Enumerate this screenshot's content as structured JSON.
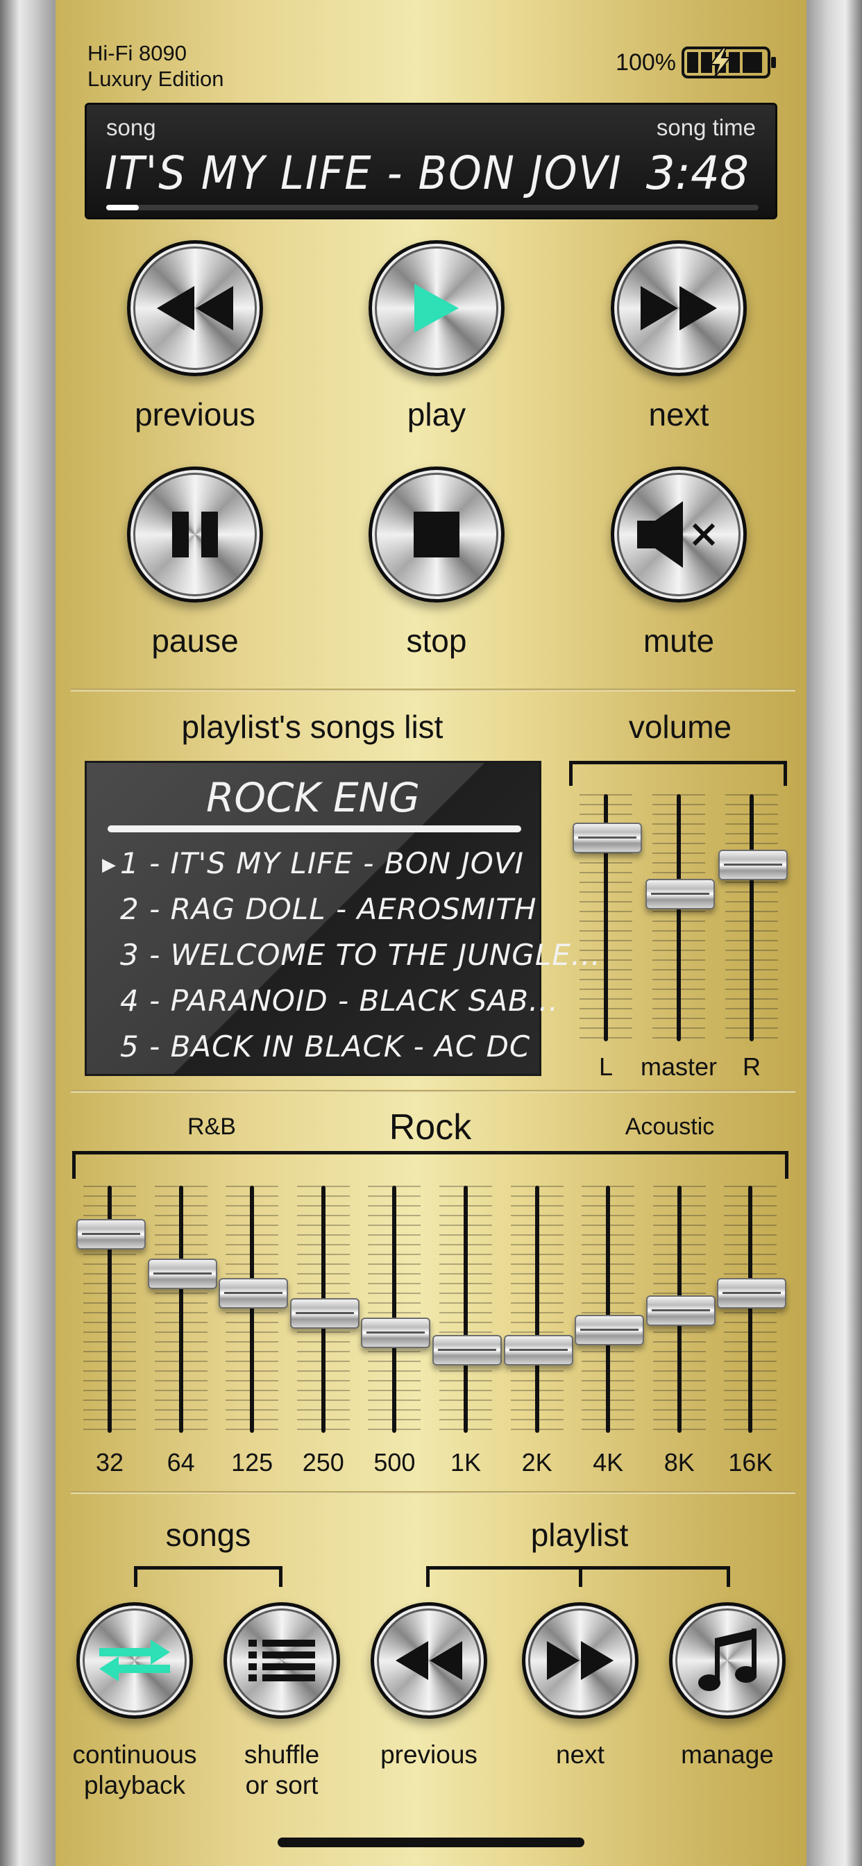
{
  "device": {
    "brand_line1": "Hi-Fi 8090",
    "brand_line2": "Luxury Edition",
    "battery": "100%",
    "battery_icon": "battery-charging-icon"
  },
  "display": {
    "song_label": "song",
    "time_label": "song time",
    "song_title": "IT'S MY LIFE - BON JOVI",
    "song_time": "3:48",
    "progress": 0.05
  },
  "transport": {
    "previous": "previous",
    "play": "play",
    "next": "next",
    "pause": "pause",
    "stop": "stop",
    "mute": "mute",
    "play_accent": "#2de0b5"
  },
  "playlist": {
    "section_title": "playlist's songs list",
    "name": "ROCK ENG",
    "songs": [
      "1 - IT'S MY LIFE - BON JOVI",
      "2 - RAG DOLL - AEROSMITH",
      "3 - WELCOME TO THE JUNGLE...",
      "4 - PARANOID - BLACK SAB...",
      "5 - BACK IN BLACK - AC DC"
    ],
    "current_index": 0
  },
  "volume": {
    "title": "volume",
    "sliders": [
      {
        "label": "L",
        "level": 0.83
      },
      {
        "label": "master",
        "level": 0.6
      },
      {
        "label": "R",
        "level": 0.72
      }
    ]
  },
  "equalizer": {
    "preset_left": "R&B",
    "preset_current": "Rock",
    "preset_right": "Acoustic",
    "bands": [
      {
        "label": "32",
        "level": 0.81
      },
      {
        "label": "64",
        "level": 0.65
      },
      {
        "label": "125",
        "level": 0.57
      },
      {
        "label": "250",
        "level": 0.49
      },
      {
        "label": "500",
        "level": 0.41
      },
      {
        "label": "1K",
        "level": 0.34
      },
      {
        "label": "2K",
        "level": 0.34
      },
      {
        "label": "4K",
        "level": 0.42
      },
      {
        "label": "8K",
        "level": 0.5
      },
      {
        "label": "16K",
        "level": 0.57
      }
    ]
  },
  "bottom": {
    "songs_title": "songs",
    "playlist_title": "playlist",
    "continuous_1": "continuous",
    "continuous_2": "playback",
    "shuffle_1": "shuffle",
    "shuffle_2": "or sort",
    "pl_previous": "previous",
    "pl_next": "next",
    "pl_manage": "manage",
    "repeat_accent": "#2de0b5"
  }
}
